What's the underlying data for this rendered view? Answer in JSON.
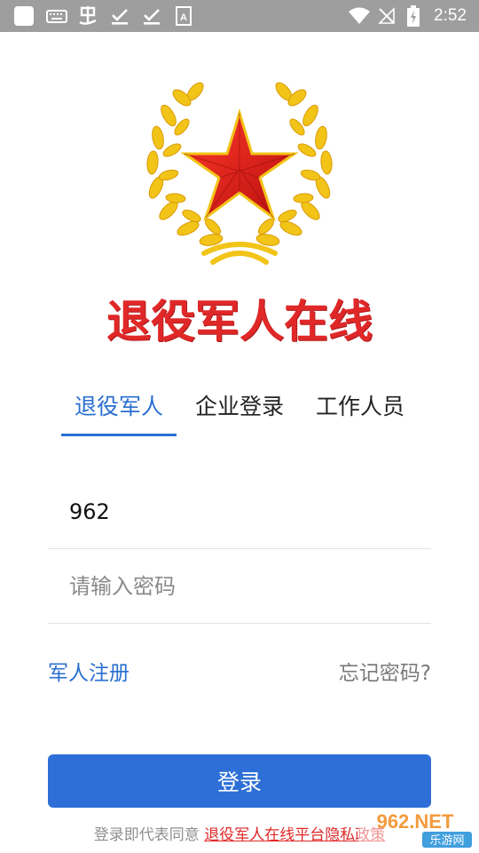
{
  "status_bar": {
    "time": "2:52",
    "left_icons": [
      "app-square-icon",
      "keyboard-icon",
      "chinese-input-icon",
      "download-done-icon",
      "download-done-icon",
      "font-a-icon"
    ],
    "right_icons": [
      "wifi-icon",
      "no-signal-icon",
      "battery-charging-icon"
    ]
  },
  "app": {
    "title": "退役军人在线",
    "emblem_colors": {
      "star": "#d32020",
      "wreath": "#f2c418"
    }
  },
  "tabs": [
    {
      "label": "退役军人",
      "active": true
    },
    {
      "label": "企业登录",
      "active": false
    },
    {
      "label": "工作人员",
      "active": false
    }
  ],
  "form": {
    "account_value": "962",
    "password_placeholder": "请输入密码"
  },
  "links": {
    "register": "军人注册",
    "forgot": "忘记密码?"
  },
  "login_button": "登录",
  "agreement": {
    "prefix": "登录即代表同意 ",
    "policy": "退役军人在线平台隐私政策"
  },
  "watermark": {
    "top": "962.NET",
    "bottom": "乐游网"
  },
  "colors": {
    "accent": "#2a6fd0",
    "button": "#2d6fd6",
    "title_red": "#e02828",
    "status_bar": "#9e9e9e"
  }
}
